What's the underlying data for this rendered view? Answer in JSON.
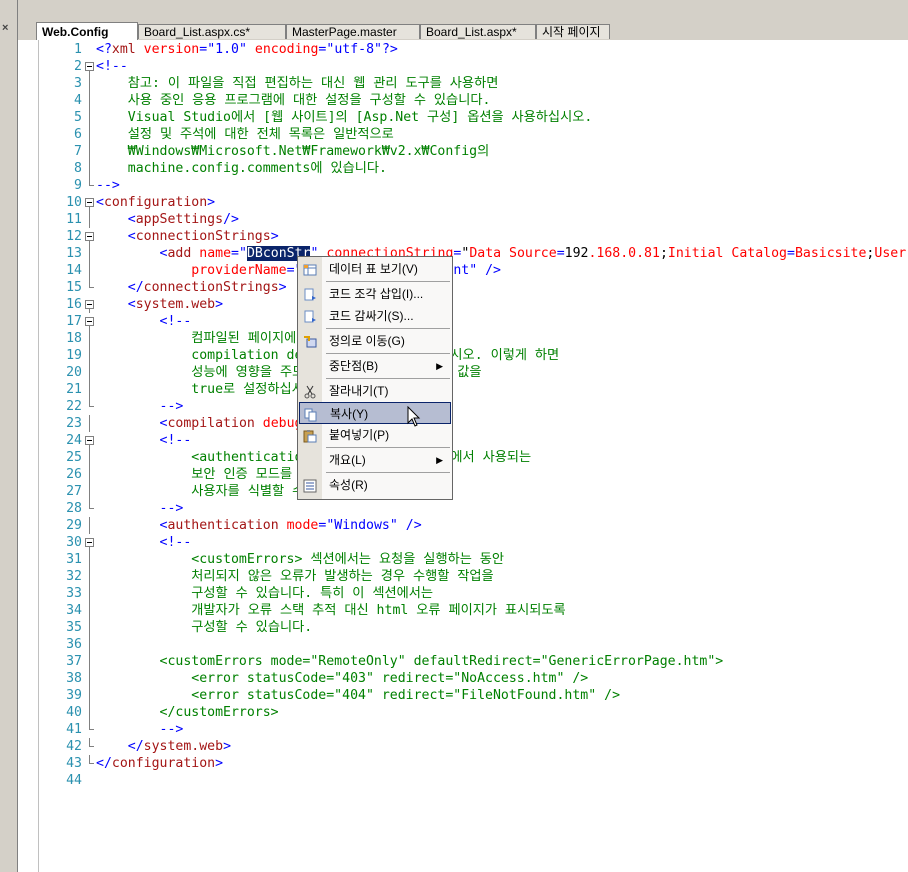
{
  "tabs": [
    {
      "label": "Web.Config",
      "active": true
    },
    {
      "label": "Board_List.aspx.cs*",
      "active": false
    },
    {
      "label": "MasterPage.master",
      "active": false
    },
    {
      "label": "Board_List.aspx*",
      "active": false
    },
    {
      "label": "시작 페이지",
      "active": false
    }
  ],
  "close_label": "×",
  "lines": [
    {
      "n": "1",
      "t": "<?xml version=\"1.0\" encoding=\"utf-8\"?>"
    },
    {
      "n": "2",
      "t": "<!--"
    },
    {
      "n": "3",
      "t": "    참고: 이 파일을 직접 편집하는 대신 웹 관리 도구를 사용하면"
    },
    {
      "n": "4",
      "t": "    사용 중인 응용 프로그램에 대한 설정을 구성할 수 있습니다."
    },
    {
      "n": "5",
      "t": "    Visual Studio에서 [웹 사이트]의 [Asp.Net 구성] 옵션을 사용하십시오."
    },
    {
      "n": "6",
      "t": "    설정 및 주석에 대한 전체 목록은 일반적으로"
    },
    {
      "n": "7",
      "t": "    ₩Windows₩Microsoft.Net₩Framework₩v2.x₩Config의"
    },
    {
      "n": "8",
      "t": "    machine.config.comments에 있습니다."
    },
    {
      "n": "9",
      "t": "-->"
    },
    {
      "n": "10",
      "t": "<configuration>"
    },
    {
      "n": "11",
      "t": "    <appSettings/>"
    },
    {
      "n": "12",
      "t": "    <connectionStrings>"
    },
    {
      "n": "13",
      "t": "        <add name=\"DBconStr\" connectionString=\"Data Source=192.168.0.81;Initial Catalog=Basicsite;User"
    },
    {
      "n": "14",
      "t": "            providerName=\"System.Data.SqlClient\" />"
    },
    {
      "n": "15",
      "t": "    </connectionStrings>"
    },
    {
      "n": "16",
      "t": "    <system.web>"
    },
    {
      "n": "17",
      "t": "        <!--"
    },
    {
      "n": "18",
      "t": "            컴파일된 페이지에 디버깅 기호를 삽입하려면"
    },
    {
      "n": "19",
      "t": "            compilation debug=\"true\"로 설정하십시오. 이렇게 하면"
    },
    {
      "n": "20",
      "t": "            성능에 영향을 주므로 개발하는 동안에만 이 값을"
    },
    {
      "n": "21",
      "t": "            true로 설정하십시오."
    },
    {
      "n": "22",
      "t": "        -->"
    },
    {
      "n": "23",
      "t": "        <compilation debug=\"true\"/>"
    },
    {
      "n": "24",
      "t": "        <!--"
    },
    {
      "n": "25",
      "t": "            <authentication> 섹션에서는 ASP.NET에서 사용되는"
    },
    {
      "n": "26",
      "t": "            보안 인증 모드를 구성하여 들어오는"
    },
    {
      "n": "27",
      "t": "            사용자를 식별할 수 있습니다."
    },
    {
      "n": "28",
      "t": "        -->"
    },
    {
      "n": "29",
      "t": "        <authentication mode=\"Windows\" />"
    },
    {
      "n": "30",
      "t": "        <!--"
    },
    {
      "n": "31",
      "t": "            <customErrors> 섹션에서는 요청을 실행하는 동안"
    },
    {
      "n": "32",
      "t": "            처리되지 않은 오류가 발생하는 경우 수행할 작업을"
    },
    {
      "n": "33",
      "t": "            구성할 수 있습니다. 특히 이 섹션에서는"
    },
    {
      "n": "34",
      "t": "            개발자가 오류 스택 추적 대신 html 오류 페이지가 표시되도록"
    },
    {
      "n": "35",
      "t": "            구성할 수 있습니다."
    },
    {
      "n": "36",
      "t": ""
    },
    {
      "n": "37",
      "t": "        <customErrors mode=\"RemoteOnly\" defaultRedirect=\"GenericErrorPage.htm\">"
    },
    {
      "n": "38",
      "t": "            <error statusCode=\"403\" redirect=\"NoAccess.htm\" />"
    },
    {
      "n": "39",
      "t": "            <error statusCode=\"404\" redirect=\"FileNotFound.htm\" />"
    },
    {
      "n": "40",
      "t": "        </customErrors>"
    },
    {
      "n": "41",
      "t": "        -->"
    },
    {
      "n": "42",
      "t": "    </system.web>"
    },
    {
      "n": "43",
      "t": "</configuration>"
    },
    {
      "n": "44",
      "t": ""
    }
  ],
  "selected_text": "DBconStr",
  "context_menu": [
    {
      "label": "데이터 표 보기(V)",
      "icon": "table-icon",
      "arrow": false,
      "highlight": false
    },
    {
      "sep": true
    },
    {
      "label": "코드 조각 삽입(I)...",
      "icon": "snippet-insert-icon",
      "arrow": false,
      "highlight": false
    },
    {
      "label": "코드 감싸기(S)...",
      "icon": "surround-with-icon",
      "arrow": false,
      "highlight": false
    },
    {
      "sep": true
    },
    {
      "label": "정의로 이동(G)",
      "icon": "go-to-definition-icon",
      "arrow": false,
      "highlight": false
    },
    {
      "sep": true
    },
    {
      "label": "중단점(B)",
      "icon": "",
      "arrow": true,
      "highlight": false
    },
    {
      "sep": true
    },
    {
      "label": "잘라내기(T)",
      "icon": "scissors-icon",
      "arrow": false,
      "highlight": false
    },
    {
      "label": "복사(Y)",
      "icon": "copy-icon",
      "arrow": false,
      "highlight": true
    },
    {
      "label": "붙여넣기(P)",
      "icon": "paste-icon",
      "arrow": false,
      "highlight": false
    },
    {
      "sep": true
    },
    {
      "label": "개요(L)",
      "icon": "",
      "arrow": true,
      "highlight": false
    },
    {
      "sep": true
    },
    {
      "label": "속성(R)",
      "icon": "properties-icon",
      "arrow": false,
      "highlight": false
    }
  ],
  "colors": {
    "keyword": "#0000ff",
    "element": "#a31515",
    "attribute": "#ff0000",
    "comment": "#008000",
    "selection": "#0a246a",
    "menu_highlight": "#b6bdd2"
  }
}
